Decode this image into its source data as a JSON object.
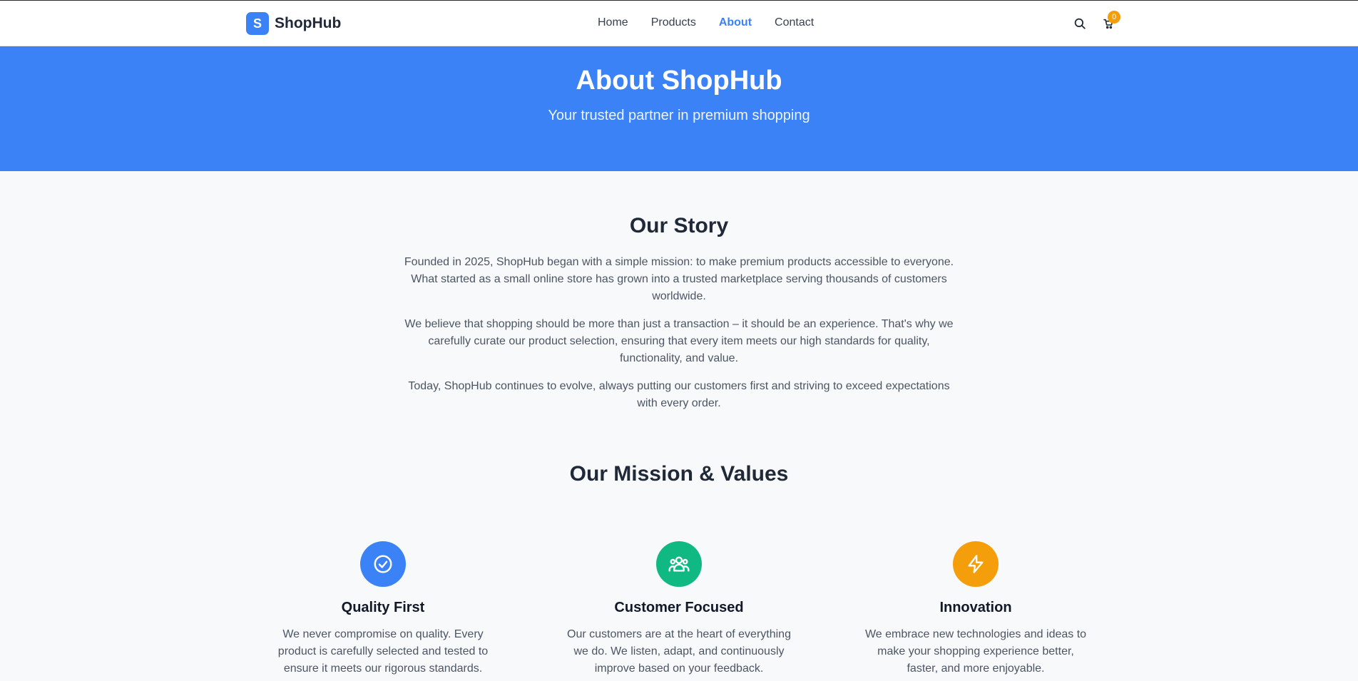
{
  "brand": {
    "initial": "S",
    "name": "ShopHub"
  },
  "nav": {
    "items": [
      {
        "label": "Home"
      },
      {
        "label": "Products"
      },
      {
        "label": "About"
      },
      {
        "label": "Contact"
      }
    ],
    "active": "About"
  },
  "header": {
    "search_icon": "search-icon",
    "cart_icon": "cart-icon",
    "cart_count": "0"
  },
  "hero": {
    "title": "About ShopHub",
    "subtitle": "Your trusted partner in premium shopping"
  },
  "story": {
    "title": "Our Story",
    "paragraphs": [
      "Founded in 2025, ShopHub began with a simple mission: to make premium products accessible to everyone. What started as a small online store has grown into a trusted marketplace serving thousands of customers worldwide.",
      "We believe that shopping should be more than just a transaction – it should be an experience. That's why we carefully curate our product selection, ensuring that every item meets our high standards for quality, functionality, and value.",
      "Today, ShopHub continues to evolve, always putting our customers first and striving to exceed expectations with every order."
    ]
  },
  "mission": {
    "title": "Our Mission & Values",
    "values": [
      {
        "title": "Quality First",
        "icon": "check-circle-icon",
        "color": "#3b82f6",
        "text": "We never compromise on quality. Every product is carefully selected and tested to ensure it meets our rigorous standards."
      },
      {
        "title": "Customer Focused",
        "icon": "users-icon",
        "color": "#10b981",
        "text": "Our customers are at the heart of everything we do. We listen, adapt, and continuously improve based on your feedback."
      },
      {
        "title": "Innovation",
        "icon": "lightning-icon",
        "color": "#f59e0b",
        "text": "We embrace new technologies and ideas to make your shopping experience better, faster, and more enjoyable."
      }
    ]
  }
}
